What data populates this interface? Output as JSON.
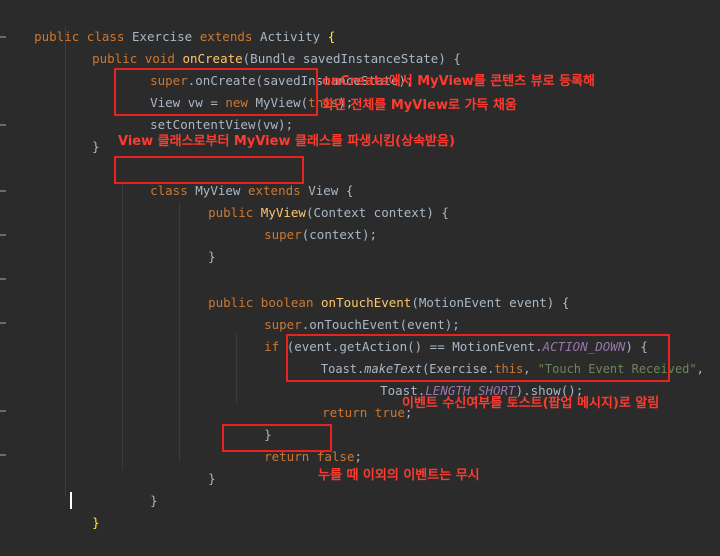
{
  "code": {
    "l1": {
      "kw1": "public",
      "kw2": "class",
      "name": "Exercise",
      "kw3": "extends",
      "parent": "Activity",
      "brace": "{"
    },
    "l2": {
      "kw1": "public",
      "kw2": "void",
      "method": "onCreate",
      "params": "(Bundle savedInstanceState) {"
    },
    "l3": {
      "sup": "super",
      "rest": ".onCreate(savedInstanceState);"
    },
    "l4": {
      "t1": "View vw = ",
      "kw": "new",
      "t2": " MyView(",
      "th": "this",
      "t3": ");"
    },
    "l5": {
      "text": "setContentView(vw);"
    },
    "l6": {
      "text": "}"
    },
    "l7": {
      "kw1": "class",
      "name": "MyView",
      "kw2": "extends",
      "parent": "View",
      "brace": "{"
    },
    "l8": {
      "kw": "public",
      "method": "MyView",
      "params": "(Context context) {"
    },
    "l9": {
      "sup": "super",
      "rest": "(context);"
    },
    "l10": {
      "text": "}"
    },
    "l11": {
      "kw1": "public",
      "kw2": "boolean",
      "method": "onTouchEvent",
      "params": "(MotionEvent event) {"
    },
    "l12": {
      "sup": "super",
      "rest": ".onTouchEvent(event);"
    },
    "l13": {
      "kw": "if",
      "t1": " (event.getAction() == MotionEvent.",
      "const": "ACTION_DOWN",
      "t2": ") {"
    },
    "l14": {
      "t1": "Toast.",
      "m": "makeText",
      "t2": "(Exercise.",
      "th": "this",
      "t3": ", ",
      "str": "\"Touch Event Received\"",
      "t4": ","
    },
    "l15": {
      "t1": "Toast.",
      "const": "LENGTH_SHORT",
      "t2": ").show();"
    },
    "l16": {
      "kw": "return",
      "kw2": "true",
      "t": ";"
    },
    "l17": {
      "text": "}"
    },
    "l18": {
      "kw": "return",
      "kw2": "false",
      "t": ";"
    },
    "l19": {
      "text": "}"
    },
    "l20": {
      "text": "}"
    },
    "l21": {
      "text": "}"
    }
  },
  "annotations": {
    "a1": "onCreate에서 MyView를 콘텐츠 뷰로 등록해",
    "a2": "화면 전체를 MyVIew로 가득 채움",
    "a3": "View 클래스로부터 MyView 클래스를 파생시킴(상속받음)",
    "a4": "이벤트 수신여부를 토스트(팝업 메시지)로 알림",
    "a5": "누를 때 이외의 이벤트는 무시"
  },
  "colors": {
    "background": "#2b2b2b",
    "keyword": "#cc7832",
    "method": "#ffc66d",
    "annotation": "#ff3b30",
    "box": "#e8221f"
  }
}
